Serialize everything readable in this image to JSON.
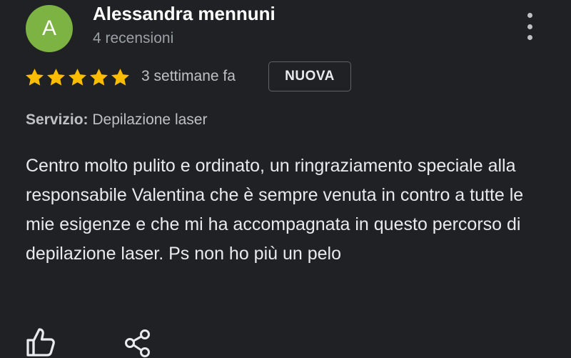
{
  "reviewer": {
    "avatar_initial": "A",
    "avatar_color": "#7cb342",
    "name": "Alessandra mennuni",
    "review_count": "4 recensioni"
  },
  "review": {
    "rating": 5,
    "rating_max": 5,
    "star_color": "#fbbc04",
    "time_ago": "3 settimane fa",
    "badge": "NUOVA",
    "service_label": "Servizio:",
    "service_value": "Depilazione laser",
    "text": "Centro molto pulito e ordinato, un ringraziamento speciale alla responsabile Valentina che è sempre venuta in contro a tutte le mie esigenze e che mi ha accompagnata in questo percorso di depilazione laser. Ps non ho più un pelo"
  },
  "icons": {
    "menu": "more-vert-icon",
    "like": "thumb-up-icon",
    "share": "share-icon",
    "star": "star-icon"
  }
}
